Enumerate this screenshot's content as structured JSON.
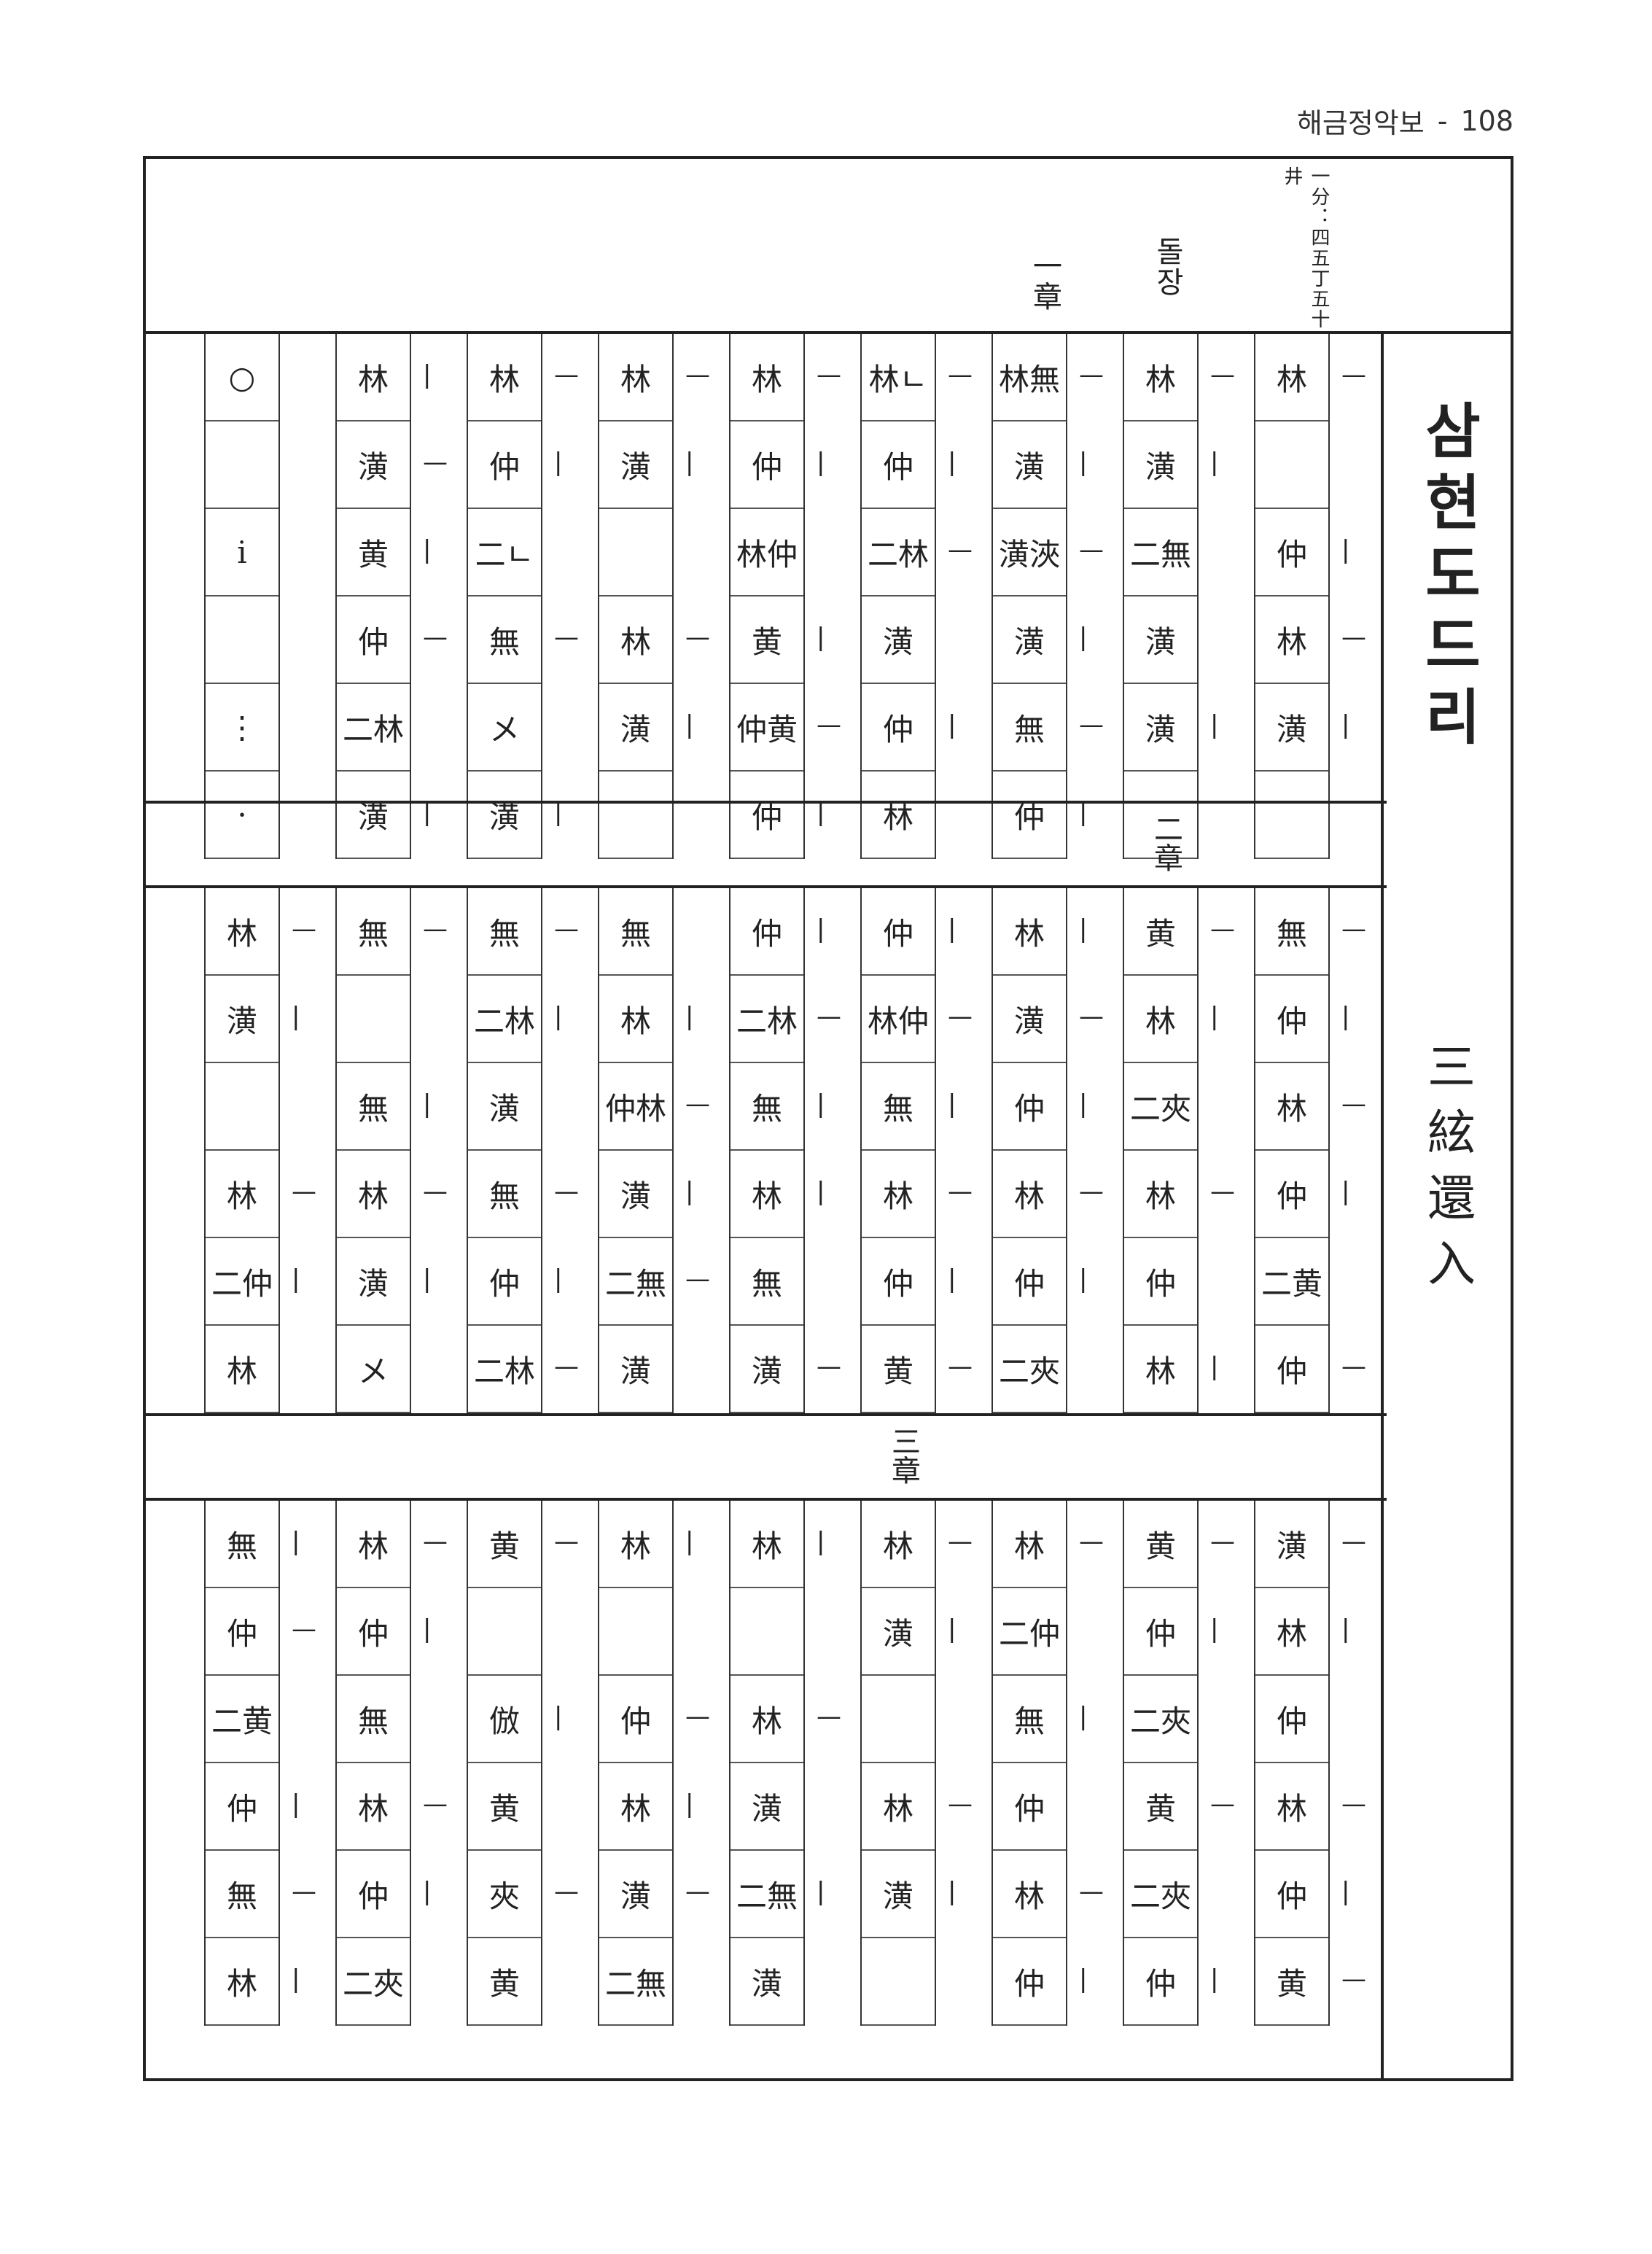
{
  "header": {
    "book_title": "해금정악보",
    "separator": "-",
    "page_number": "108"
  },
  "meta": {
    "chapter_one": "一章",
    "dolsang": "돌장",
    "timing": "一分：四五丁五十井"
  },
  "title": {
    "korean": "삼현도드리",
    "hanja": "三絃還入"
  },
  "sections": [
    {
      "label": "",
      "columns": [
        {
          "notes": [
            "○",
            "",
            "ⅰ",
            "",
            "⋮",
            "·"
          ],
          "marks": [
            "",
            "",
            "",
            "",
            "",
            ""
          ]
        },
        {
          "notes": [
            "林",
            "潢",
            "黄",
            "仲",
            "二林",
            "潢"
          ],
          "marks": [
            "|",
            "—",
            "|",
            "—",
            "",
            "|"
          ]
        },
        {
          "notes": [
            "林",
            "仲",
            "二ㄴ",
            "無",
            "メ",
            "潢"
          ],
          "marks": [
            "—",
            "|",
            "",
            "—",
            "",
            "|"
          ]
        },
        {
          "notes": [
            "林",
            "潢",
            "",
            "林",
            "潢",
            ""
          ],
          "marks": [
            "—",
            "|",
            "",
            "—",
            "|",
            ""
          ]
        },
        {
          "notes": [
            "林",
            "仲",
            "林仲",
            "黄",
            "仲黄",
            "仲"
          ],
          "marks": [
            "—",
            "|",
            "",
            "|",
            "—",
            "|"
          ]
        },
        {
          "notes": [
            "林ㄴ",
            "仲",
            "二林",
            "潢",
            "仲",
            "林"
          ],
          "marks": [
            "—",
            "|",
            "—",
            "",
            "|",
            ""
          ]
        },
        {
          "notes": [
            "林無",
            "潢",
            "潢浹",
            "潢",
            "無",
            "仲"
          ],
          "marks": [
            "—",
            "|",
            "—",
            "|",
            "—",
            "|"
          ]
        },
        {
          "notes": [
            "林",
            "潢",
            "二無",
            "潢",
            "潢",
            ""
          ],
          "marks": [
            "—",
            "|",
            "",
            "",
            "|",
            ""
          ]
        },
        {
          "notes": [
            "林",
            "",
            "仲",
            "林",
            "潢",
            ""
          ],
          "marks": [
            "—",
            "",
            "|",
            "—",
            "|",
            ""
          ]
        }
      ]
    },
    {
      "label": "二章",
      "columns": [
        {
          "notes": [
            "林",
            "潢",
            "",
            "林",
            "二仲",
            "林"
          ],
          "marks": [
            "—",
            "|",
            "",
            "—",
            "|",
            ""
          ]
        },
        {
          "notes": [
            "無",
            "",
            "無",
            "林",
            "潢",
            "メ"
          ],
          "marks": [
            "—",
            "",
            "|",
            "—",
            "|",
            ""
          ]
        },
        {
          "notes": [
            "無",
            "二林",
            "潢",
            "無",
            "仲",
            "二林"
          ],
          "marks": [
            "—",
            "|",
            "",
            "—",
            "|",
            "—"
          ]
        },
        {
          "notes": [
            "無",
            "林",
            "仲林",
            "潢",
            "二無",
            "潢"
          ],
          "marks": [
            "",
            "|",
            "—",
            "|",
            "—",
            ""
          ]
        },
        {
          "notes": [
            "仲",
            "二林",
            "無",
            "林",
            "無",
            "潢"
          ],
          "marks": [
            "|",
            "—",
            "|",
            "|",
            "",
            "—"
          ]
        },
        {
          "notes": [
            "仲",
            "林仲",
            "無",
            "林",
            "仲",
            "黄"
          ],
          "marks": [
            "|",
            "—",
            "|",
            "—",
            "|",
            "—"
          ]
        },
        {
          "notes": [
            "林",
            "潢",
            "仲",
            "林",
            "仲",
            "二夾"
          ],
          "marks": [
            "|",
            "—",
            "|",
            "—",
            "|",
            ""
          ]
        },
        {
          "notes": [
            "黄",
            "林",
            "二夾",
            "林",
            "仲",
            "林"
          ],
          "marks": [
            "—",
            "|",
            "",
            "—",
            "",
            "|"
          ]
        },
        {
          "notes": [
            "無",
            "仲",
            "林",
            "仲",
            "二黄",
            "仲"
          ],
          "marks": [
            "—",
            "|",
            "—",
            "|",
            "",
            "—"
          ]
        }
      ]
    },
    {
      "label": "三章",
      "columns": [
        {
          "notes": [
            "無",
            "仲",
            "二黄",
            "仲",
            "無",
            "林"
          ],
          "marks": [
            "|",
            "—",
            "",
            "|",
            "—",
            "|"
          ]
        },
        {
          "notes": [
            "林",
            "仲",
            "無",
            "林",
            "仲",
            "二夾"
          ],
          "marks": [
            "—",
            "|",
            "",
            "—",
            "|",
            ""
          ]
        },
        {
          "notes": [
            "黄",
            "",
            "倣",
            "黄",
            "夾",
            "黄"
          ],
          "marks": [
            "—",
            "",
            "|",
            "",
            "—",
            ""
          ]
        },
        {
          "notes": [
            "林",
            "",
            "仲",
            "林",
            "潢",
            "二無"
          ],
          "marks": [
            "|",
            "",
            "—",
            "|",
            "—",
            ""
          ]
        },
        {
          "notes": [
            "林",
            "",
            "林",
            "潢",
            "二無",
            "潢"
          ],
          "marks": [
            "|",
            "",
            "—",
            "",
            "|",
            ""
          ]
        },
        {
          "notes": [
            "林",
            "潢",
            "",
            "林",
            "潢",
            ""
          ],
          "marks": [
            "—",
            "|",
            "",
            "—",
            "|",
            ""
          ]
        },
        {
          "notes": [
            "林",
            "二仲",
            "無",
            "仲",
            "林",
            "仲"
          ],
          "marks": [
            "—",
            "",
            "|",
            "",
            "—",
            "|"
          ]
        },
        {
          "notes": [
            "黄",
            "仲",
            "二夾",
            "黄",
            "二夾",
            "仲"
          ],
          "marks": [
            "—",
            "|",
            "",
            "—",
            "",
            "|"
          ]
        },
        {
          "notes": [
            "潢",
            "林",
            "仲",
            "林",
            "仲",
            "黄"
          ],
          "marks": [
            "—",
            "|",
            "",
            "—",
            "|",
            "—"
          ]
        }
      ]
    }
  ]
}
